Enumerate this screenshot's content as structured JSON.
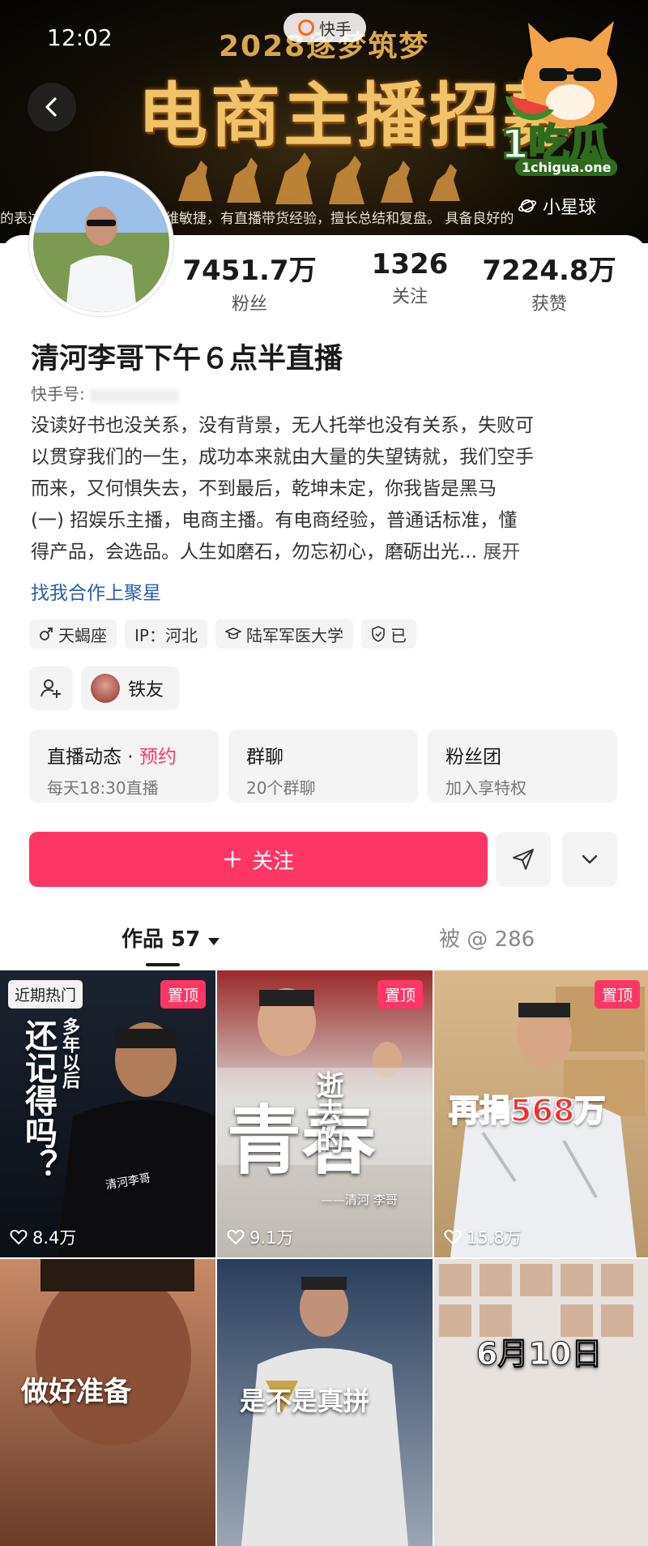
{
  "status_bar": {
    "time": "12:02"
  },
  "app": {
    "name": "快手"
  },
  "banner": {
    "year_text": "2028逐梦筑梦",
    "title": "电商主播招募",
    "caption": "的表达能力，逻辑清晰，思维敏捷，有直播带货经验，擅长总结和复盘。   具备良好的"
  },
  "watermark": {
    "brand": "1吃瓜",
    "url": "1chigua.one"
  },
  "planet": {
    "label": "小星球"
  },
  "stats": [
    {
      "value": "7451.7万",
      "label": "粉丝"
    },
    {
      "value": "1326",
      "label": "关注"
    },
    {
      "value": "7224.8万",
      "label": "获赞"
    }
  ],
  "profile": {
    "name": "清河李哥下午６点半直播",
    "id_label": "快手号:",
    "bio_lines": [
      "没读好书也没关系，没有背景，无人托举也没有关系，失败可",
      "以贯穿我们的一生，成功本来就由大量的失望铸就，我们空手",
      "而来，又何惧失去，不到最后，乾坤未定，你我皆是黑马",
      "(一) 招娱乐主播，电商主播。有电商经验，普通话标准，懂",
      "得产品，会选品。人生如磨石，勿忘初心，磨砺出光... "
    ],
    "expand": "展开",
    "collab": "找我合作上聚星"
  },
  "tags": [
    {
      "icon": "male-icon",
      "text": "天蝎座"
    },
    {
      "icon": "",
      "text": "IP：河北"
    },
    {
      "icon": "school-icon",
      "text": "陆军军医大学"
    },
    {
      "icon": "shield-icon",
      "text": "已"
    }
  ],
  "friends": {
    "chip_label": "铁友"
  },
  "info_cards": [
    {
      "title": "直播动态 · ",
      "accent": "预约",
      "sub": "每天18:30直播"
    },
    {
      "title": "群聊",
      "accent": "",
      "sub": "20个群聊"
    },
    {
      "title": "粉丝团",
      "accent": "",
      "sub": "加入享特权"
    }
  ],
  "actions": {
    "follow_label": "关注"
  },
  "tabs": {
    "works_label": "作品 57",
    "mentions_label": "被 @ 286"
  },
  "videos": [
    {
      "likes": "8.4万",
      "pinned": "置顶",
      "badge": "近期热门",
      "overlay": "还记得吗？",
      "side_text": "多年以后",
      "sign": "清河李哥"
    },
    {
      "likes": "9.1万",
      "pinned": "置顶",
      "badge": "",
      "overlay": "青春",
      "side_text": "逝去的",
      "sign": "——清河 李哥"
    },
    {
      "likes": "15.8万",
      "pinned": "置顶",
      "badge": "",
      "overlay": "再捐568万",
      "side_text": "",
      "sign": ""
    },
    {
      "likes": "",
      "pinned": "",
      "badge": "",
      "overlay": "做好准备",
      "side_text": "",
      "sign": ""
    },
    {
      "likes": "",
      "pinned": "",
      "badge": "",
      "overlay": "是不是真拼",
      "side_text": "",
      "sign": ""
    },
    {
      "likes": "",
      "pinned": "",
      "badge": "",
      "overlay": "6月10日",
      "side_text": "",
      "sign": ""
    }
  ],
  "colors": {
    "accent": "#fe3666",
    "link": "#2a5db0",
    "chip_bg": "#f4f4f5"
  }
}
